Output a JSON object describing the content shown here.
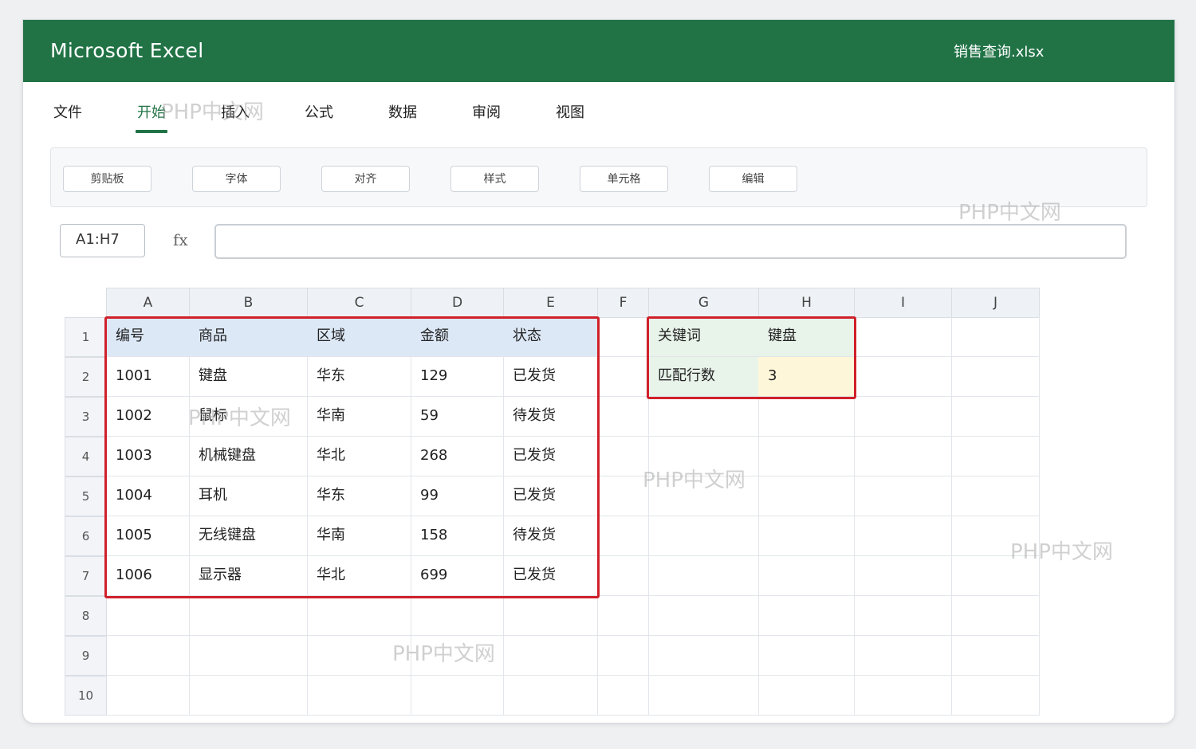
{
  "app": {
    "title": "Microsoft Excel",
    "file_name": "销售查询.xlsx"
  },
  "tabs": [
    "文件",
    "开始",
    "插入",
    "公式",
    "数据",
    "审阅",
    "视图"
  ],
  "active_tab": "开始",
  "ribbon": [
    "剪贴板",
    "字体",
    "对齐",
    "样式",
    "单元格",
    "编辑"
  ],
  "formula_bar": {
    "name_box": "A1:H7",
    "fx": "fx",
    "formula": ""
  },
  "sheet": {
    "columns": [
      "A",
      "B",
      "C",
      "D",
      "E",
      "F",
      "G",
      "H",
      "I",
      "J"
    ],
    "row_numbers": [
      "1",
      "2",
      "3",
      "4",
      "5",
      "6",
      "7",
      "8",
      "9",
      "10"
    ],
    "table": {
      "headers": [
        "编号",
        "商品",
        "区域",
        "金额",
        "状态"
      ],
      "rows": [
        [
          "1001",
          "键盘",
          "华东",
          "129",
          "已发货"
        ],
        [
          "1002",
          "鼠标",
          "华南",
          "59",
          "待发货"
        ],
        [
          "1003",
          "机械键盘",
          "华北",
          "268",
          "已发货"
        ],
        [
          "1004",
          "耳机",
          "华东",
          "99",
          "已发货"
        ],
        [
          "1005",
          "无线键盘",
          "华南",
          "158",
          "待发货"
        ],
        [
          "1006",
          "显示器",
          "华北",
          "699",
          "已发货"
        ]
      ]
    },
    "lookup": {
      "keyword_label": "关键词",
      "keyword_value": "键盘",
      "count_label": "匹配行数",
      "count_value": "3"
    }
  },
  "watermark": "PHP中文网",
  "colors": {
    "brand": "#217346",
    "selection": "#d0202a",
    "header_fill": "#dde8f7",
    "key_fill": "#e8f3ea",
    "result_fill": "#fdf6d8"
  }
}
